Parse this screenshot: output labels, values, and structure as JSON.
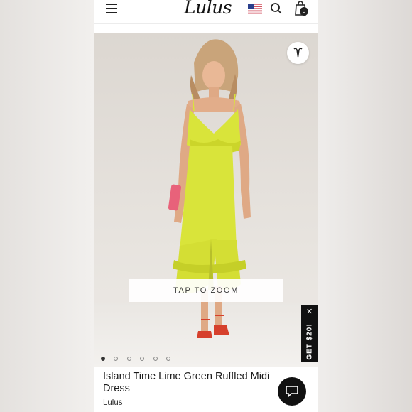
{
  "header": {
    "logo": "Lulus",
    "cart_count": "0",
    "icons": [
      "menu-icon",
      "us-flag-icon",
      "search-icon",
      "shopping-bag-icon"
    ]
  },
  "product": {
    "title": "Island Time Lime Green Ruffled Midi Dress",
    "brand": "Lulus",
    "zoom_label": "TAP TO ZOOM",
    "image_count": 6,
    "active_image": 1
  },
  "promo": {
    "label": "GET $20!",
    "close": "✕"
  },
  "colors": {
    "dress": "#d9e43a",
    "accent_dark": "#111111",
    "shoes": "#d6402c",
    "clutch": "#e8627a"
  }
}
